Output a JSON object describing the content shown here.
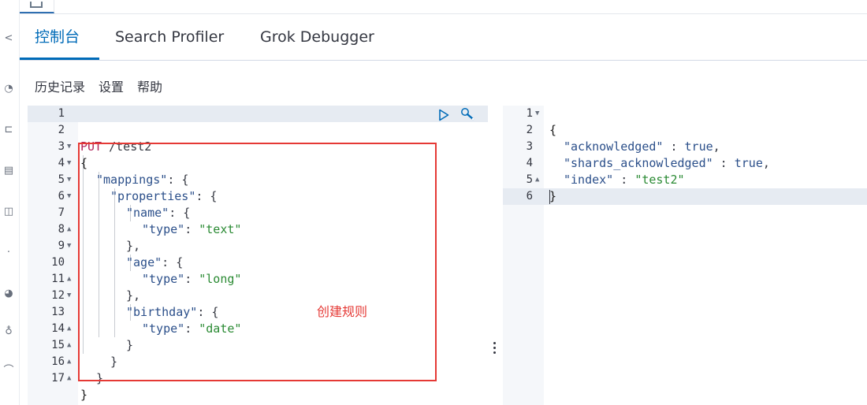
{
  "app": {
    "tabs": [
      {
        "label": "控制台",
        "active": true
      },
      {
        "label": "Search Profiler",
        "active": false
      },
      {
        "label": "Grok Debugger",
        "active": false
      }
    ],
    "subnav": [
      "历史记录",
      "设置",
      "帮助"
    ]
  },
  "request_editor": {
    "lines": [
      {
        "n": "1",
        "fold": ""
      },
      {
        "n": "2",
        "fold": ""
      },
      {
        "n": "3",
        "fold": "▼"
      },
      {
        "n": "4",
        "fold": "▼"
      },
      {
        "n": "5",
        "fold": "▼"
      },
      {
        "n": "6",
        "fold": "▼"
      },
      {
        "n": "7",
        "fold": ""
      },
      {
        "n": "8",
        "fold": "▲"
      },
      {
        "n": "9",
        "fold": "▼"
      },
      {
        "n": "10",
        "fold": ""
      },
      {
        "n": "11",
        "fold": "▲"
      },
      {
        "n": "12",
        "fold": "▼"
      },
      {
        "n": "13",
        "fold": ""
      },
      {
        "n": "14",
        "fold": "▲"
      },
      {
        "n": "15",
        "fold": "▲"
      },
      {
        "n": "16",
        "fold": "▲"
      },
      {
        "n": "17",
        "fold": "▲"
      }
    ],
    "method": "PUT",
    "url": "/test2",
    "tokens": {
      "open_brace": "{",
      "mappings_key": "\"mappings\"",
      "properties_key": "\"properties\"",
      "name_key": "\"name\"",
      "type_key": "\"type\"",
      "text_val": "\"text\"",
      "age_key": "\"age\"",
      "long_val": "\"long\"",
      "birthday_key": "\"birthday\"",
      "date_val": "\"date\"",
      "colon_brace": ": {",
      "colon": ": ",
      "close_comma": "},",
      "close": "}"
    },
    "actions": {
      "run_icon": "play-icon",
      "wrench_icon": "wrench-icon"
    }
  },
  "annotation": {
    "text": "创建规则",
    "color": "#e53935"
  },
  "response_editor": {
    "lines": [
      {
        "n": "1",
        "fold": "▼"
      },
      {
        "n": "2",
        "fold": ""
      },
      {
        "n": "3",
        "fold": ""
      },
      {
        "n": "4",
        "fold": ""
      },
      {
        "n": "5",
        "fold": "▲"
      },
      {
        "n": "6",
        "fold": ""
      }
    ],
    "tokens": {
      "open": "{",
      "ack_key": "\"acknowledged\"",
      "shards_key": "\"shards_acknowledged\"",
      "index_key": "\"index\"",
      "sep": " : ",
      "true_val": "true",
      "comma": ",",
      "index_val": "\"test2\"",
      "close": "}"
    }
  },
  "colors": {
    "accent": "#006bb8",
    "method": "#b0255b",
    "string": "#2a8a33",
    "key": "#2b4f8a"
  }
}
